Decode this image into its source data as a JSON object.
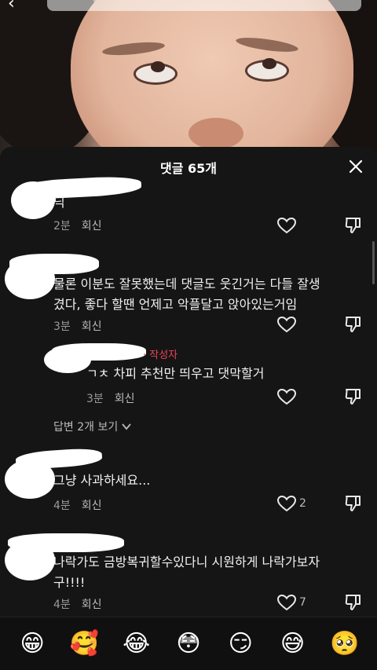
{
  "sheet": {
    "title": "댓글 65개"
  },
  "comments": [
    {
      "text": "닉",
      "time": "2분",
      "reply_label": "회신",
      "like_count": ""
    },
    {
      "text_line1": "물론 이분도 잘못했는데 댓글도 웃긴거는 다들 잘생",
      "text_line2": "겼다, 좋다 할땐 언제고 악플달고 앉아있는거임",
      "time": "3분",
      "reply_label": "회신",
      "like_count": ""
    },
    {
      "author_tag": "· 작성자",
      "text": "ㄱㅊ 차피 추천만 띄우고 댓막할거",
      "time": "3분",
      "reply_label": "회신",
      "like_count": ""
    },
    {
      "text": "그냥 사과하세요...",
      "time": "4분",
      "reply_label": "회신",
      "like_count": "2"
    },
    {
      "text_line1": "나락가도 금방복귀할수있다니 시원하게 나락가보자",
      "text_line2": "구!!!!",
      "time": "4분",
      "reply_label": "회신",
      "like_count": "7"
    }
  ],
  "view_replies": "답변 2개 보기",
  "emoji_bar": [
    "😁",
    "🥰",
    "😂",
    "😳",
    "😏",
    "😅",
    "🥺"
  ],
  "icons": {
    "like": "heart-outline-icon",
    "dislike": "thumb-down-outline-icon",
    "close": "close-icon",
    "expand": "chevron-down-icon"
  }
}
